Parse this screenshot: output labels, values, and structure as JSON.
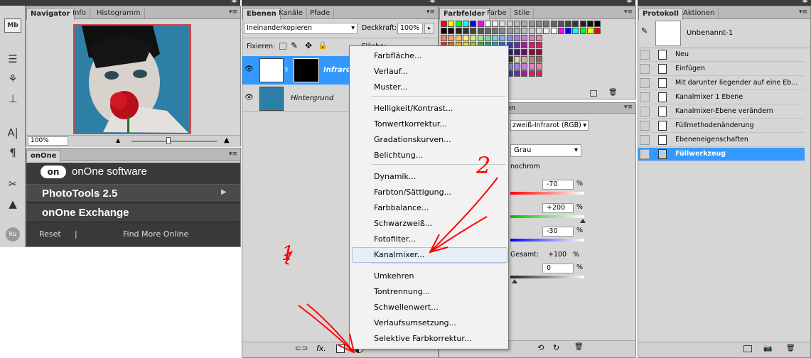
{
  "navigator_panel": {
    "tabs": [
      "Navigator",
      "Info",
      "Histogramm"
    ],
    "zoom": "100%"
  },
  "onone_panel": {
    "tab": "onOne",
    "brand": "onOne software",
    "logo_text": "on",
    "items": [
      "PhotoTools 2.5",
      "onOne Exchange"
    ],
    "reset": "Reset",
    "separator": "|",
    "find_more": "Find More Online"
  },
  "left_tools": {
    "badge": "Mb",
    "ku": "ku"
  },
  "layers_panel": {
    "tabs": [
      "Ebenen",
      "Kanäle",
      "Pfade"
    ],
    "blend_mode": "Ineinanderkopieren",
    "opacity_label": "Deckkraft:",
    "opacity_value": "100%",
    "lock_label": "Fixieren:",
    "fill_label": "Fläche:",
    "layers": [
      {
        "name": "Infrarot",
        "selected": true
      },
      {
        "name": "Hintergrund",
        "selected": false
      }
    ],
    "fx_label": "fx."
  },
  "swatches_panel": {
    "tabs": [
      "Farbfelder",
      "Farbe",
      "Stile"
    ]
  },
  "adjust_panel": {
    "tab_label": "ken",
    "preset": "zweiß-Infrarot (RGB)",
    "output": "Grau",
    "monochrom": "nochrom",
    "channels": [
      {
        "value": "-70",
        "unit": "%"
      },
      {
        "value": "+200",
        "unit": "%"
      },
      {
        "value": "-30",
        "unit": "%"
      }
    ],
    "total_label": "Gesamt:",
    "total_value": "+100",
    "total_unit": "%",
    "constant_value": "0",
    "constant_unit": "%"
  },
  "history_panel": {
    "tabs": [
      "Protokoll",
      "Aktionen"
    ],
    "snapshot": "Unbenannt-1",
    "items": [
      "Neu",
      "Einfügen",
      "Mit darunter liegender auf eine Eb...",
      "Kanalmixer 1 Ebene",
      "Kanalmixer-Ebene verändern",
      "Füllmethodenänderung",
      "Ebeneneigenschaften",
      "Füllwerkzeug"
    ],
    "selected_index": 7
  },
  "context_menu": {
    "items": [
      "Farbfläche...",
      "Verlauf...",
      "Muster...",
      "Helligkeit/Kontrast...",
      "Tonwertkorrektur...",
      "Gradationskurven...",
      "Belichtung...",
      "Dynamik...",
      "Farbton/Sättigung...",
      "Farbbalance...",
      "Schwarzweiß...",
      "Fotofilter...",
      "Kanalmixer...",
      "Umkehren",
      "Tontrennung...",
      "Schwellenwert...",
      "Verlaufsumsetzung...",
      "Selektive Farbkorrektur..."
    ],
    "highlighted": "Kanalmixer..."
  },
  "annotations": {
    "one": "1",
    "two": "2"
  },
  "colors": {
    "accent": "#3399ff",
    "annotation": "#ff0000",
    "panel": "#d6d6d6"
  }
}
